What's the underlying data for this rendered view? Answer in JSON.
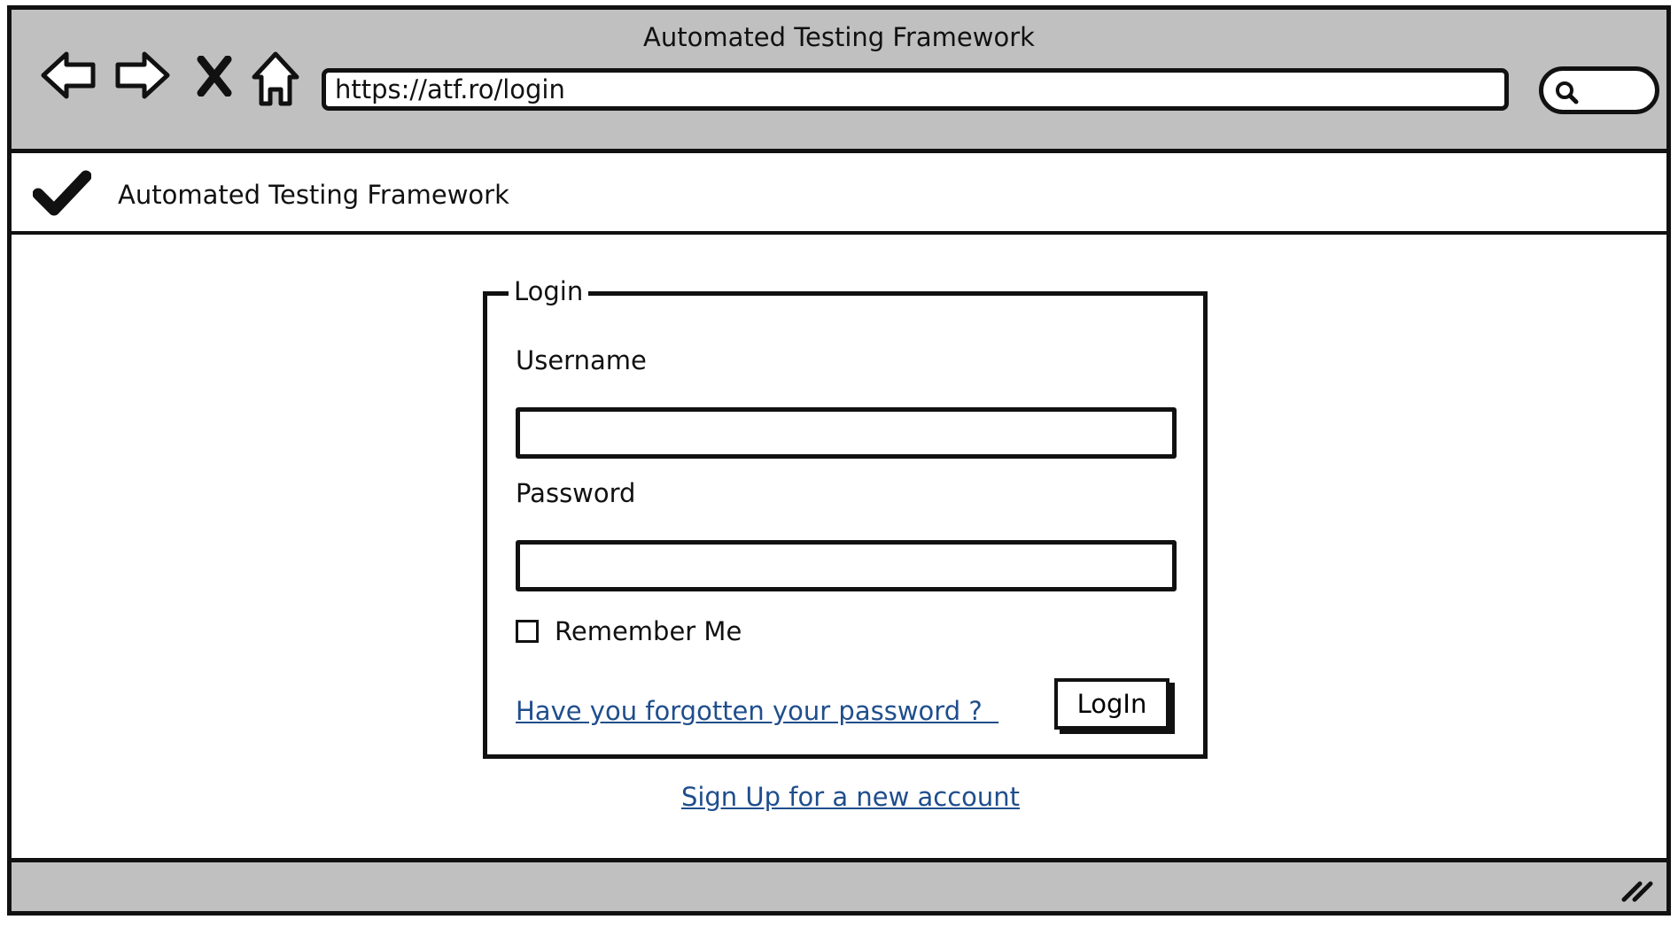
{
  "window": {
    "title": "Automated Testing Framework"
  },
  "browser": {
    "url": "https://atf.ro/login",
    "nav_icons": [
      "back-arrow-icon",
      "forward-arrow-icon",
      "stop-icon",
      "home-icon"
    ],
    "search_icon": "search-icon"
  },
  "app": {
    "logo_icon": "checkmark-icon",
    "title": "Automated Testing Framework"
  },
  "login": {
    "legend": "Login",
    "username_label": "Username",
    "username_value": "",
    "password_label": "Password",
    "password_value": "",
    "remember_label": "Remember Me",
    "remember_checked": false,
    "forgot_link": "Have you forgotten your password ?  ",
    "submit_label": "LogIn"
  },
  "signup_link": "Sign Up for a new account",
  "colors": {
    "chrome_gray": "#c0c0c0",
    "link_blue": "#1f4e8c",
    "stroke": "#111111"
  }
}
